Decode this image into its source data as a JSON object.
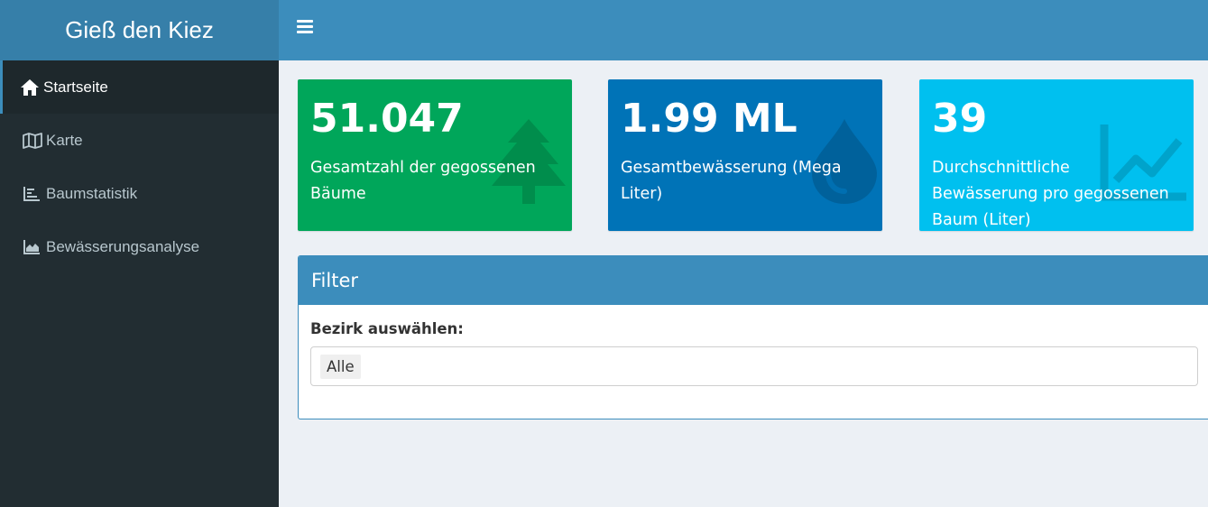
{
  "header": {
    "app_title": "Gieß den Kiez",
    "menu_icon": "hamburger-icon"
  },
  "sidebar": {
    "items": [
      {
        "label": "Startseite",
        "icon": "home-icon",
        "active": true
      },
      {
        "label": "Karte",
        "icon": "map-icon",
        "active": false
      },
      {
        "label": "Baumstatistik",
        "icon": "bar-list-icon",
        "active": false
      },
      {
        "label": "Bewässerungsanalyse",
        "icon": "area-chart-icon",
        "active": false
      }
    ]
  },
  "stats": [
    {
      "value": "51.047",
      "description": "Gesamtzahl der gegossenen Bäume",
      "icon": "tree-icon",
      "color": "#00a65a"
    },
    {
      "value": "1.99 ML",
      "description": "Gesamtbewässerung (Mega Liter)",
      "icon": "water-drop-icon",
      "color": "#0073b7"
    },
    {
      "value": "39",
      "description": "Durchschnittliche Bewässerung pro gegossenen Baum (Liter)",
      "icon": "line-chart-icon",
      "color": "#00c0ef"
    }
  ],
  "filter": {
    "title": "Filter",
    "district_label": "Bezirk auswählen:",
    "district_selected": "Alle"
  },
  "colors": {
    "header": "#3c8dbc",
    "logo": "#367fa9",
    "sidebar": "#222d32",
    "background": "#ecf0f5"
  }
}
